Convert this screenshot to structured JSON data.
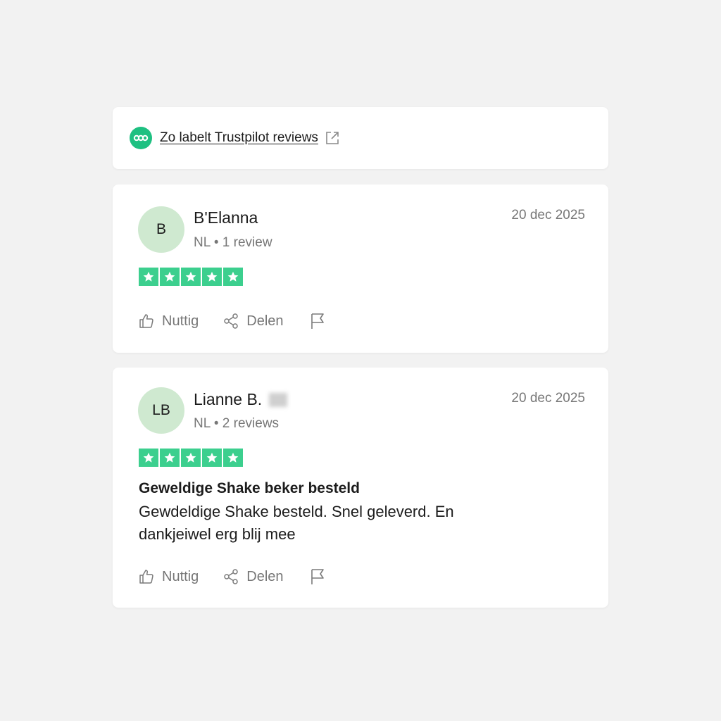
{
  "info": {
    "link_label": "Zo labelt Trustpilot reviews",
    "brand_icon": "trustpilot-label-icon",
    "external_icon": "external-link-icon"
  },
  "colors": {
    "accent": "#1ec081",
    "star_green": "#3ccf8e",
    "avatar_green": "#cfe9d0",
    "muted_text": "#777777",
    "background": "#f2f2f2"
  },
  "reviews": [
    {
      "avatar_initials": "B",
      "name": "B'Elanna",
      "meta": "NL • 1 review",
      "date": "20 dec 2025",
      "rating": 5,
      "title": "",
      "body": "",
      "actions": {
        "helpful": "Nuttig",
        "share": "Delen"
      }
    },
    {
      "avatar_initials": "LB",
      "name": "Lianne B.",
      "meta": "NL • 2 reviews",
      "date": "20 dec 2025",
      "rating": 5,
      "title": "Geweldige Shake beker besteld",
      "body": "Gewdeldige Shake besteld. Snel geleverd. En dankjeiwel erg blij mee",
      "actions": {
        "helpful": "Nuttig",
        "share": "Delen"
      }
    }
  ]
}
